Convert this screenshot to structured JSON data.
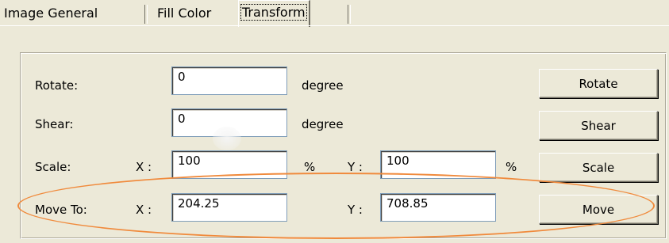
{
  "tabs": [
    {
      "label": "Image General"
    },
    {
      "label": "Fill Color"
    },
    {
      "label": "Transform",
      "active": true
    }
  ],
  "rotate": {
    "label": "Rotate:",
    "value": "0",
    "unit": "degree",
    "button": "Rotate"
  },
  "shear": {
    "label": "Shear:",
    "value": "0",
    "unit": "degree",
    "button": "Shear"
  },
  "scale": {
    "label": "Scale:",
    "x_label": "X :",
    "x_value": "100",
    "x_unit": "%",
    "y_label": "Y :",
    "y_value": "100",
    "y_unit": "%",
    "button": "Scale"
  },
  "move": {
    "label": "Move To:",
    "x_label": "X :",
    "x_value": "204.25",
    "y_label": "Y :",
    "y_value": "708.85",
    "button": "Move"
  },
  "colors": {
    "highlight": "#f08a3c",
    "background": "#ece9d8"
  }
}
